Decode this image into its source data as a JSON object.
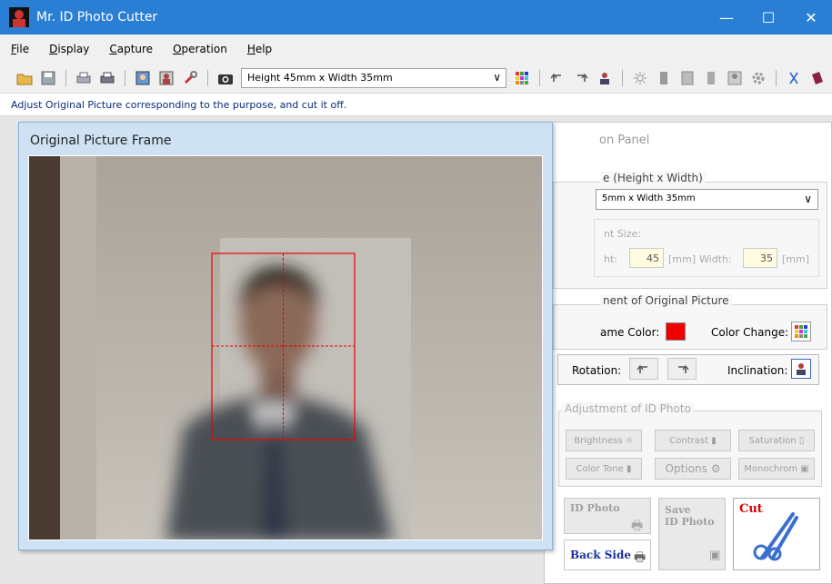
{
  "window": {
    "title": "Mr. ID Photo Cutter",
    "min_glyph": "—",
    "max_glyph": "☐",
    "close_glyph": "✕"
  },
  "menu": [
    {
      "label": "File",
      "u": "F",
      "rest": "ile"
    },
    {
      "label": "Display",
      "u": "D",
      "rest": "isplay"
    },
    {
      "label": "Capture",
      "u": "C",
      "rest": "apture"
    },
    {
      "label": "Operation",
      "u": "O",
      "rest": "peration"
    },
    {
      "label": "Help",
      "u": "H",
      "rest": "elp"
    }
  ],
  "toolbar": {
    "size_select": "Height 45mm x Width 35mm",
    "chevron": "∨"
  },
  "status": {
    "message": "Adjust Original Picture corresponding to the purpose, and cut it off."
  },
  "picture_frame": {
    "title": "Original Picture Frame"
  },
  "operation_panel": {
    "title": "on Panel",
    "size_group_label": "e (Height x Width)",
    "size_select": "5mm x Width 35mm",
    "print_size_label": "nt Size:",
    "height_label": "ht:",
    "height_value": "45",
    "height_unit": "[mm]",
    "width_label": "Width:",
    "width_value": "35",
    "width_unit": "[mm]",
    "adjust_original_label": "nent of Original Picture",
    "frame_color_label": "ame Color:",
    "frame_color": "#ee0000",
    "color_change_label": "Color Change:",
    "rotation_label": "Rotation:",
    "inclination_label": "Inclination:",
    "adjust_id_label": "Adjustment of ID Photo",
    "brightness": "Brightness",
    "contrast": "Contrast",
    "saturation": "Saturation",
    "color_tone": "Color Tone",
    "options": "Options",
    "monochrome": "Monochrom",
    "id_photo": "ID Photo",
    "save_id_photo_1": "Save",
    "save_id_photo_2": "ID Photo",
    "cut": "Cut",
    "back_side": "Back Side"
  }
}
